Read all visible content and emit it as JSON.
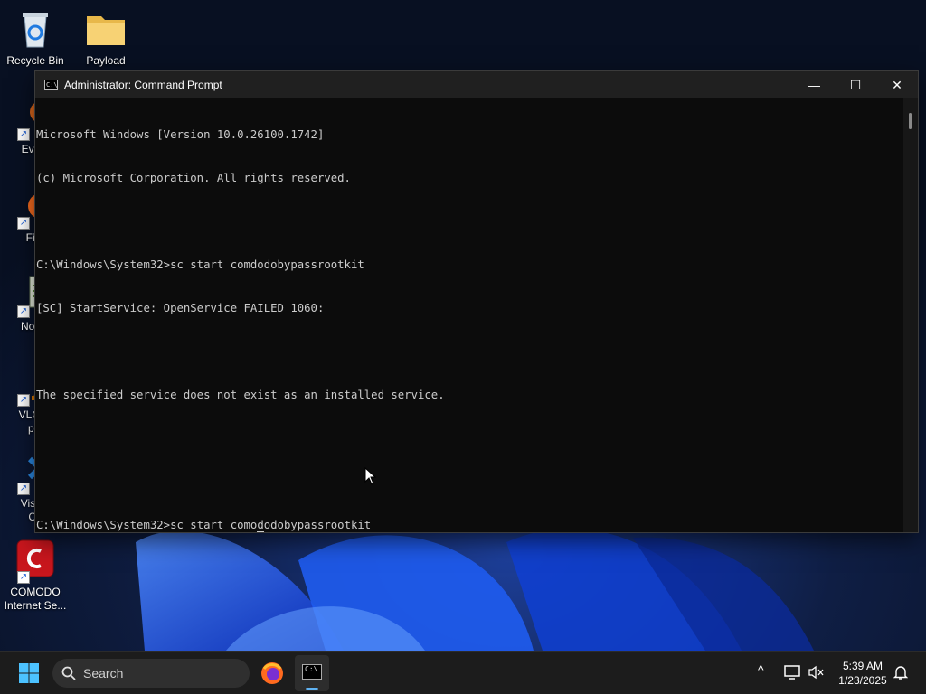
{
  "desktop": {
    "icons": [
      {
        "label": "Recycle Bin"
      },
      {
        "label": "Payload"
      },
      {
        "label": "Every"
      },
      {
        "label": "Fire"
      },
      {
        "label": "Notep"
      },
      {
        "label": "VLC m"
      },
      {
        "label": "pla"
      },
      {
        "label": "Visual"
      },
      {
        "label": "Co"
      },
      {
        "label": "COMODO"
      },
      {
        "label": "Internet Se..."
      }
    ]
  },
  "window": {
    "title": "Administrator: Command Prompt",
    "app_icon_text": "C:\\",
    "controls": {
      "minimize": "—",
      "maximize": "☐",
      "close": "✕"
    }
  },
  "console": {
    "lines": [
      "Microsoft Windows [Version 10.0.26100.1742]",
      "(c) Microsoft Corporation. All rights reserved.",
      "",
      "C:\\Windows\\System32>sc start comdodobypassrootkit",
      "[SC] StartService: OpenService FAILED 1060:",
      "",
      "The specified service does not exist as an installed service.",
      "",
      ""
    ],
    "current_prompt": "C:\\Windows\\System32>",
    "current_input_before_cursor": "sc start como",
    "current_input_at_cursor": "d",
    "current_input_after_cursor": "odobypassrootkit"
  },
  "taskbar": {
    "search_placeholder": "Search",
    "clock_time": "5:39 AM",
    "clock_date": "1/23/2025",
    "tray_chevron": "^",
    "colors": {
      "background": "#1c1c1c",
      "accent": "#5fb2f2"
    }
  }
}
